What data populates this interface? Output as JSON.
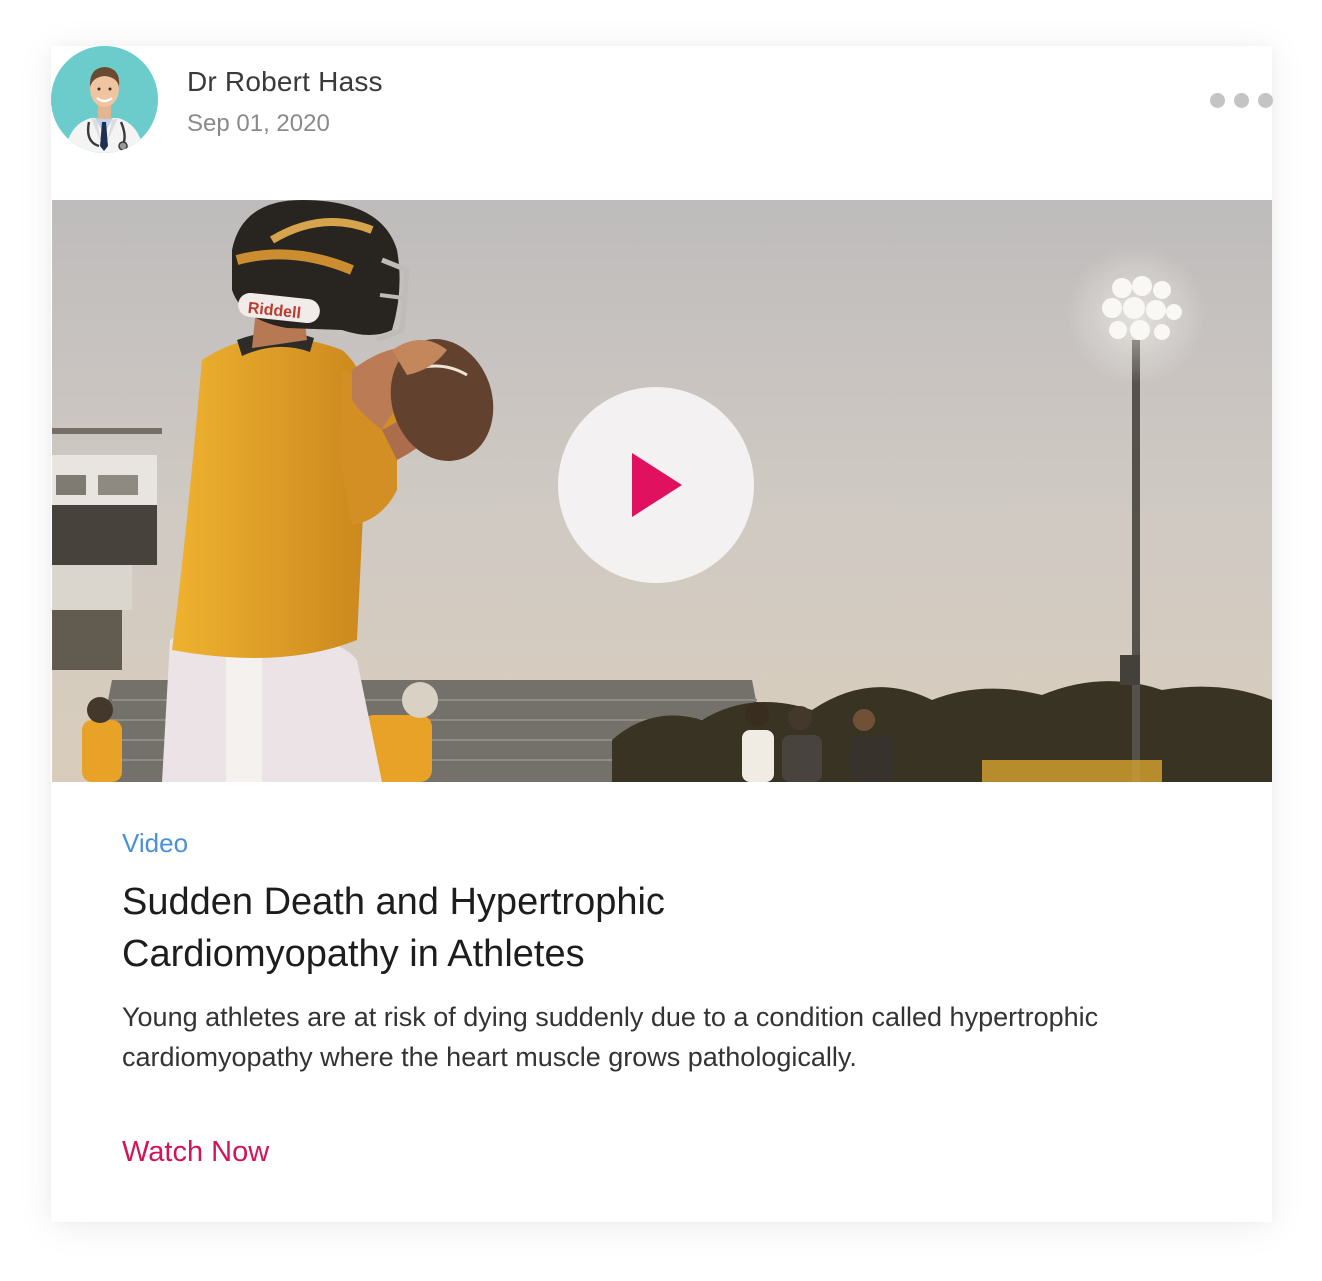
{
  "author": {
    "name": "Dr Robert Hass",
    "date": "Sep 01, 2020",
    "avatar_icon": "doctor-avatar"
  },
  "menu": {
    "icon": "more-horizontal-icon"
  },
  "media": {
    "image_description_icon": "football-player-photo",
    "play_icon": "play-icon",
    "helmet_brand": "Riddell"
  },
  "content": {
    "category": "Video",
    "title": "Sudden Death and Hypertrophic Cardiomyopathy in Athletes",
    "description": "Young athletes are at risk of dying suddenly due to a condition called hypertrophic cardiomyopathy where the heart muscle grows pathologically.",
    "cta_label": "Watch Now"
  },
  "colors": {
    "category": "#4a90d9",
    "cta": "#d4145a",
    "play_triangle": "#e0115f",
    "avatar_bg": "#6ccccc",
    "jersey": "#e9a321"
  }
}
